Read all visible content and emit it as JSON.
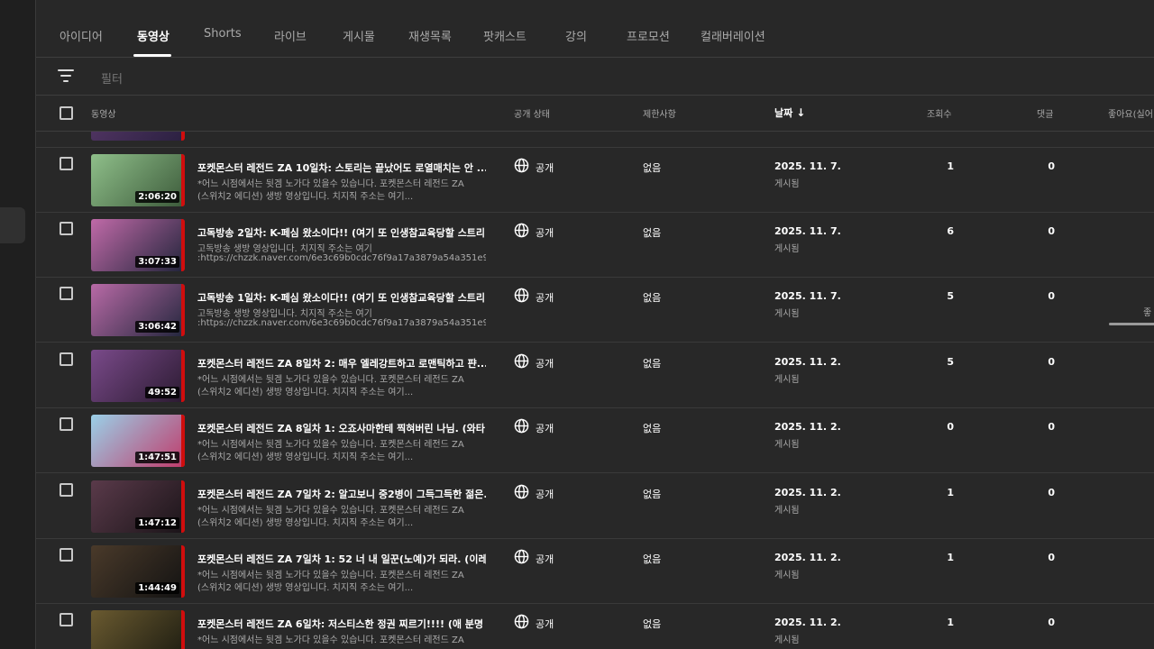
{
  "tabs": [
    {
      "label": "아이디어",
      "active": false
    },
    {
      "label": "동영상",
      "active": true
    },
    {
      "label": "Shorts",
      "active": false
    },
    {
      "label": "라이브",
      "active": false
    },
    {
      "label": "게시물",
      "active": false
    },
    {
      "label": "재생목록",
      "active": false
    },
    {
      "label": "팟캐스트",
      "active": false
    },
    {
      "label": "강의",
      "active": false
    },
    {
      "label": "프로모션",
      "active": false
    },
    {
      "label": "컬래버레이션",
      "active": false
    }
  ],
  "filter": {
    "placeholder": "필터",
    "icon": "filter-icon"
  },
  "columns": {
    "video": "동영상",
    "visibility": "공개 상태",
    "restrictions": "제한사항",
    "date": "날짜",
    "date_sort": "↓",
    "views": "조회수",
    "comments": "댓글",
    "likes": "좋아요(실어"
  },
  "likes_partial": "좋",
  "accent_color": "#d00d0d",
  "videos": [
    {
      "title": "포켓몬스터 레전드 ZA 10일차: 스토리는 끝났어도 로열매치는 안 ...",
      "desc1": "*어느 시점에서는 뒷겜 노가다 있을수 있습니다. 포켓몬스터 레전드 ZA",
      "desc2": "(스위치2 에디션) 생방 영상입니다. 치지직 주소는 여기...",
      "duration": "2:06:20",
      "visibility": "공개",
      "restriction": "없음",
      "date": "2025. 11. 7.",
      "date_status": "게시됨",
      "views": "1",
      "comments": "0",
      "thumb_colors": [
        "#8fbf8a",
        "#3c5a3a"
      ]
    },
    {
      "title": "고독방송 2일차: K-페심 왔소이다!! (여기 또 인생참교육당할 스트리...",
      "desc1": "고독방송 생방 영상입니다. 치지직 주소는 여기",
      "desc2": ":https://chzzk.naver.com/6e3c69b0cdc76f9a17a3879a54a351e9...",
      "duration": "3:07:33",
      "visibility": "공개",
      "restriction": "없음",
      "date": "2025. 11. 7.",
      "date_status": "게시됨",
      "views": "6",
      "comments": "0",
      "thumb_colors": [
        "#c06aa8",
        "#20243a"
      ]
    },
    {
      "title": "고독방송 1일차: K-페심 왔소이다!! (여기 또 인생참교육당할 스트리...",
      "desc1": "고독방송 생방 영상입니다. 치지직 주소는 여기",
      "desc2": ":https://chzzk.naver.com/6e3c69b0cdc76f9a17a3879a54a351e9...",
      "duration": "3:06:42",
      "visibility": "공개",
      "restriction": "없음",
      "date": "2025. 11. 7.",
      "date_status": "게시됨",
      "views": "5",
      "comments": "0",
      "thumb_colors": [
        "#b86aa6",
        "#22263c"
      ]
    },
    {
      "title": "포켓몬스터 레전드 ZA 8일차 2: 매우 엘레강트하고 로맨틱하고 퍈...",
      "desc1": "*어느 시점에서는 뒷겜 노가다 있을수 있습니다. 포켓몬스터 레전드 ZA",
      "desc2": "(스위치2 에디션) 생방 영상입니다. 치지직 주소는 여기...",
      "duration": "49:52",
      "visibility": "공개",
      "restriction": "없음",
      "date": "2025. 11. 2.",
      "date_status": "게시됨",
      "views": "5",
      "comments": "0",
      "thumb_colors": [
        "#7a4a8a",
        "#2a1a30"
      ]
    },
    {
      "title": "포켓몬스터 레전드 ZA 8일차 1: 오죠사마한테 찍혀버린 나님. (와타...",
      "desc1": "*어느 시점에서는 뒷겜 노가다 있을수 있습니다. 포켓몬스터 레전드 ZA",
      "desc2": "(스위치2 에디션) 생방 영상입니다. 치지직 주소는 여기...",
      "duration": "1:47:51",
      "visibility": "공개",
      "restriction": "없음",
      "date": "2025. 11. 2.",
      "date_status": "게시됨",
      "views": "0",
      "comments": "0",
      "thumb_colors": [
        "#9ad0e8",
        "#c03a6a"
      ]
    },
    {
      "title": "포켓몬스터 레전드 ZA 7일차 2: 알고보니 중2병이 그득그득한 젊은...",
      "desc1": "*어느 시점에서는 뒷겜 노가다 있을수 있습니다. 포켓몬스터 레전드 ZA",
      "desc2": "(스위치2 에디션) 생방 영상입니다. 치지직 주소는 여기...",
      "duration": "1:47:12",
      "visibility": "공개",
      "restriction": "없음",
      "date": "2025. 11. 2.",
      "date_status": "게시됨",
      "views": "1",
      "comments": "0",
      "thumb_colors": [
        "#5a3a4a",
        "#1a1418"
      ]
    },
    {
      "title": "포켓몬스터 레전드 ZA 7일차 1: 52 너 내 일꾼(노예)가 되라. (이레...",
      "desc1": "*어느 시점에서는 뒷겜 노가다 있을수 있습니다. 포켓몬스터 레전드 ZA",
      "desc2": "(스위치2 에디션) 생방 영상입니다. 치지직 주소는 여기...",
      "duration": "1:44:49",
      "visibility": "공개",
      "restriction": "없음",
      "date": "2025. 11. 2.",
      "date_status": "게시됨",
      "views": "1",
      "comments": "0",
      "thumb_colors": [
        "#4a3a2a",
        "#121212"
      ]
    },
    {
      "title": "포켓몬스터 레전드 ZA 6일차: 저스티스한 정권 찌르기!!!! (애 분명 ...",
      "desc1": "*어느 시점에서는 뒷겜 노가다 있을수 있습니다. 포켓몬스터 레전드 ZA",
      "desc2": "",
      "duration": "",
      "visibility": "공개",
      "restriction": "없음",
      "date": "2025. 11. 2.",
      "date_status": "게시됨",
      "views": "1",
      "comments": "0",
      "thumb_colors": [
        "#6a5a30",
        "#1a1a10"
      ]
    }
  ]
}
